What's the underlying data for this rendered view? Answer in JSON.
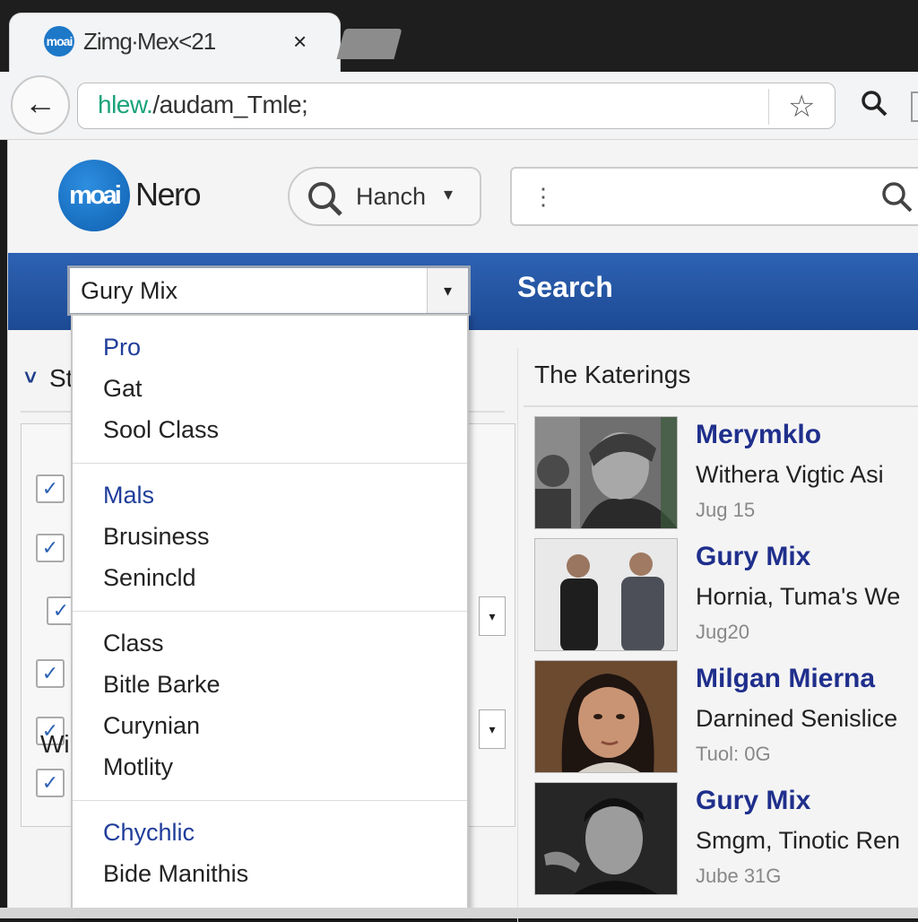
{
  "browser": {
    "tab_title": "Zimg∙Mex<21",
    "tab_close": "×",
    "address": "/audam_Tmle;",
    "address_scheme": "hlew.",
    "back_label": "←",
    "icons": [
      "back-arrow-icon",
      "star-icon",
      "search-icon",
      "close-icon"
    ]
  },
  "site": {
    "logo_text": "moai",
    "name": "Nero",
    "hanch_label": "Hanch",
    "caret": "▾",
    "search_cursor": "⋮",
    "nav_search": "Search"
  },
  "filter": {
    "selected": "Gury Mix",
    "arrow": "▾",
    "section_stub": "St",
    "bottom_stub": "Wi",
    "groups": [
      [
        "Pro",
        "Gat",
        "Sool Class"
      ],
      [
        "Mals",
        "Brusiness",
        "Senincld"
      ],
      [
        "Class",
        "Bitle Barke",
        "Curynian",
        "Motlity"
      ],
      [
        "Chychlic",
        "Bide Manithis"
      ]
    ]
  },
  "results": {
    "title": "The Katerings",
    "items": [
      {
        "title": "Merymklo",
        "sub": "Withera Vigtic Asi",
        "date": "Jug 15"
      },
      {
        "title": "Gury Mix",
        "sub": "Hornia, Tuma's We",
        "date": "Jug20"
      },
      {
        "title": "Milgan Mierna",
        "sub": "Darnined Senislice",
        "date": "Tuol: 0G"
      },
      {
        "title": "Gury Mix",
        "sub": "Smgm, Tinotic Ren",
        "date": "Jube 31G"
      }
    ]
  },
  "colors": {
    "nav_bar": "#2d62b3",
    "link_title": "#1f2f8c",
    "group_header": "#1f3d9a",
    "logo": "#1d78c8"
  }
}
